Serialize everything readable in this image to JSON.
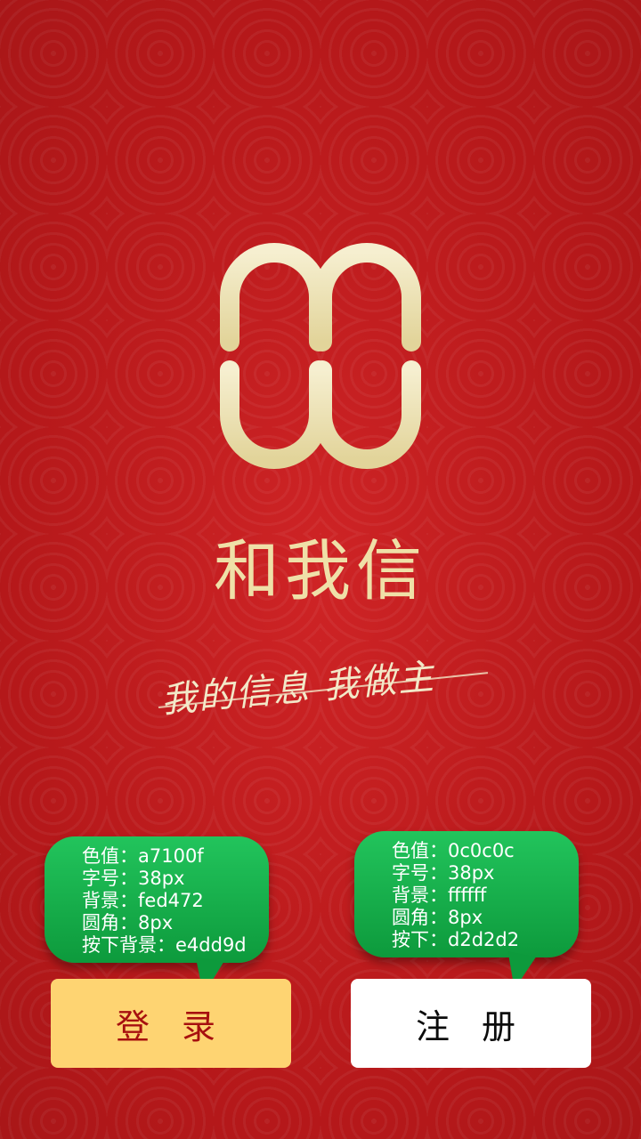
{
  "app": {
    "name": "和我信",
    "slogan": "我的信息  我做主"
  },
  "annotations": {
    "login": [
      "色值：a7100f",
      "字号：38px",
      "背景：fed472",
      "圆角：8px",
      "按下背景：e4dd9d"
    ],
    "register": [
      "色值：0c0c0c",
      "字号：38px",
      "背景：ffffff",
      "圆角：8px",
      "按下：d2d2d2"
    ]
  },
  "buttons": {
    "login_label": "登 录",
    "register_label": "注 册"
  },
  "colors": {
    "background": "#c41a1c",
    "logo": "#f1e6b8",
    "login_text": "#a7100f",
    "login_bg": "#fed472",
    "register_text": "#0c0c0c",
    "register_bg": "#ffffff",
    "bubble": "#16b04a"
  }
}
